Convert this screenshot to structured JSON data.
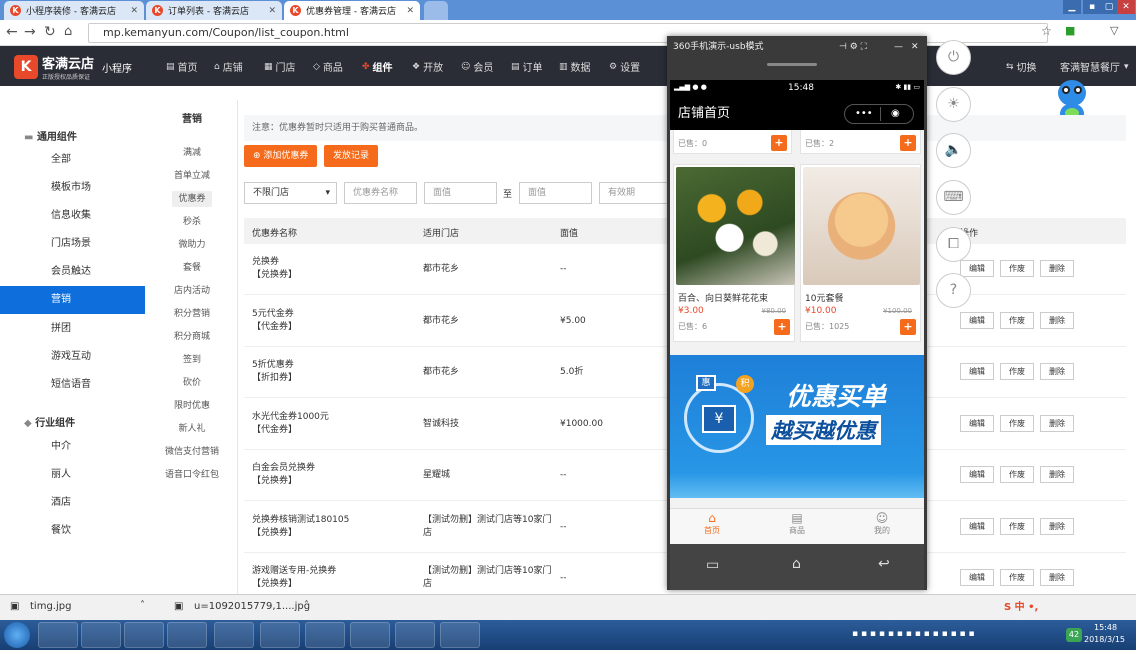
{
  "browser": {
    "tabs": [
      "小程序装修 - 客满云店",
      "订单列表 - 客满云店",
      "优惠券管理 - 客满云店"
    ],
    "url": "mp.kemanyun.com/Coupon/list_coupon.html"
  },
  "header": {
    "logo_main": "客满云店",
    "logo_sub": "正版授权品质保证",
    "product": "小程序",
    "nav": [
      "首页",
      "店铺",
      "门店",
      "商品",
      "组件",
      "开放",
      "会员",
      "订单",
      "数据",
      "设置"
    ],
    "switch": "切换",
    "account": "客满智慧餐厅"
  },
  "sidebar": {
    "group1": "通用组件",
    "items1": [
      "全部",
      "模板市场",
      "信息收集",
      "门店场景",
      "会员触达",
      "营销",
      "拼团",
      "游戏互动",
      "短信语音"
    ],
    "group2": "行业组件",
    "items2": [
      "中介",
      "丽人",
      "酒店",
      "餐饮"
    ]
  },
  "submenu": {
    "title": "营销",
    "items": [
      "满减",
      "首单立减",
      "优惠券",
      "秒杀",
      "微助力",
      "套餐",
      "店内活动",
      "积分营销",
      "积分商城",
      "签到",
      "砍价",
      "限时优惠",
      "新人礼",
      "微信支付营销",
      "语音口令红包"
    ]
  },
  "main": {
    "notice": "注意：优惠券暂时只适用于购买普通商品。",
    "add_btn": "添加优惠券",
    "record_btn": "发放记录",
    "filter": {
      "store": "不限门店",
      "name_ph": "优惠券名称",
      "value_ph": "面值",
      "to": "至",
      "value_ph2": "面值",
      "validity_ph": "有效期"
    },
    "headers": [
      "优惠券名称",
      "适用门店",
      "面值",
      "操作"
    ],
    "rows": [
      {
        "name": "兑换券",
        "type": "【兑换券】",
        "store": "都市花乡",
        "value": "--"
      },
      {
        "name": "5元代金券",
        "type": "【代金券】",
        "store": "都市花乡",
        "value": "¥5.00"
      },
      {
        "name": "5折优惠券",
        "type": "【折扣券】",
        "store": "都市花乡",
        "value": "5.0折"
      },
      {
        "name": "水光代金券1000元",
        "type": "【代金券】",
        "store": "智诚科技",
        "value": "¥1000.00"
      },
      {
        "name": "白金会员兑换券",
        "type": "【兑换券】",
        "store": "星耀城",
        "value": "--"
      },
      {
        "name": "兑换券核销测试180105",
        "type": "【兑换券】",
        "store": "【测试勿删】测试门店等10家门店",
        "value": "--"
      },
      {
        "name": "游戏赠送专用-兑换券",
        "type": "【兑换券】",
        "store": "【测试勿删】测试门店等10家门店",
        "value": "--"
      }
    ],
    "actions": [
      "编辑",
      "作废",
      "删除"
    ]
  },
  "phone": {
    "window_title": "360手机演示-usb模式",
    "time": "15:48",
    "page_title": "店铺首页",
    "top_sold": [
      "已售：0",
      "已售：2"
    ],
    "products": [
      {
        "name": "百合、向日葵鲜花花束",
        "price": "¥3.00",
        "old": "¥80.00",
        "sold": "已售：6"
      },
      {
        "name": "10元套餐",
        "price": "¥10.00",
        "old": "¥100.00",
        "sold": "已售：1025"
      }
    ],
    "banner": {
      "text1": "优惠买单",
      "text2": "越买越优惠",
      "badge1": "惠",
      "badge2": "积"
    },
    "tabs": [
      "首页",
      "商品",
      "我的"
    ]
  },
  "downloads": [
    "timg.jpg",
    "u=1092015779,1....jpg"
  ],
  "taskbar": {
    "time": "15:48",
    "date": "2018/3/15",
    "badge": "42"
  },
  "colors": {
    "accent": "#f56b1b",
    "nav_active": "#0e6fdc",
    "header_bg": "#2a2d36"
  }
}
